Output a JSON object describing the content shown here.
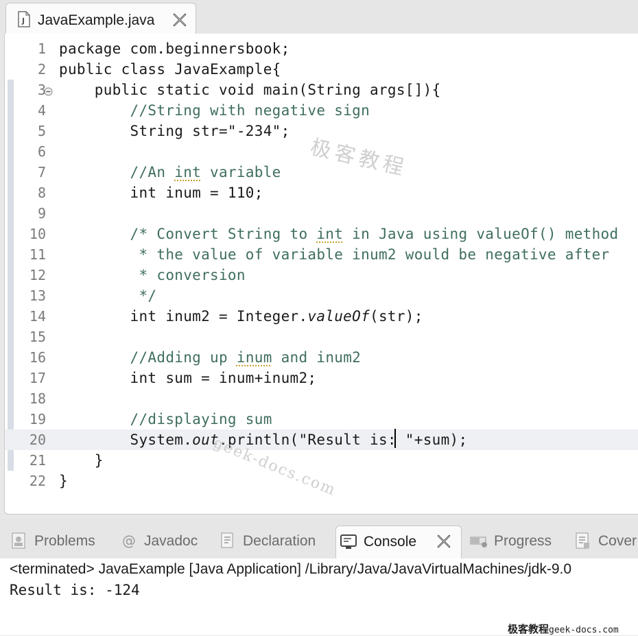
{
  "editor_tab": {
    "title": "JavaExample.java"
  },
  "lines": [
    {
      "n": "1",
      "segs": [
        {
          "t": "package com.beginnersbook;"
        }
      ]
    },
    {
      "n": "2",
      "segs": [
        {
          "t": "public class JavaExample{"
        }
      ]
    },
    {
      "n": "3",
      "fold": true,
      "segs": [
        {
          "t": "    public static void main(String args[]){"
        }
      ]
    },
    {
      "n": "4",
      "segs": [
        {
          "t": "        //String with negative sign",
          "c": "comment"
        }
      ]
    },
    {
      "n": "5",
      "segs": [
        {
          "t": "        String str=\"-234\";"
        }
      ]
    },
    {
      "n": "6",
      "segs": [
        {
          "t": ""
        }
      ]
    },
    {
      "n": "7",
      "segs": [
        {
          "t": "        //An ",
          "c": "comment"
        },
        {
          "t": "int",
          "c": "comment squiggle"
        },
        {
          "t": " variable",
          "c": "comment"
        }
      ]
    },
    {
      "n": "8",
      "segs": [
        {
          "t": "        int inum = 110;"
        }
      ]
    },
    {
      "n": "9",
      "segs": [
        {
          "t": ""
        }
      ]
    },
    {
      "n": "10",
      "segs": [
        {
          "t": "        /* Convert String to ",
          "c": "comment"
        },
        {
          "t": "int",
          "c": "comment squiggle"
        },
        {
          "t": " in Java using valueOf() method",
          "c": "comment"
        }
      ]
    },
    {
      "n": "11",
      "segs": [
        {
          "t": "         * the value of variable inum2 would be negative after",
          "c": "comment"
        }
      ]
    },
    {
      "n": "12",
      "segs": [
        {
          "t": "         * conversion",
          "c": "comment"
        }
      ]
    },
    {
      "n": "13",
      "segs": [
        {
          "t": "         */",
          "c": "comment"
        }
      ]
    },
    {
      "n": "14",
      "segs": [
        {
          "t": "        int inum2 = Integer."
        },
        {
          "t": "valueOf",
          "i": true
        },
        {
          "t": "(str);"
        }
      ]
    },
    {
      "n": "15",
      "segs": [
        {
          "t": ""
        }
      ]
    },
    {
      "n": "16",
      "segs": [
        {
          "t": "        //Adding up ",
          "c": "comment"
        },
        {
          "t": "inum",
          "c": "comment squiggle"
        },
        {
          "t": " and inum2",
          "c": "comment"
        }
      ]
    },
    {
      "n": "17",
      "segs": [
        {
          "t": "        int sum = inum+inum2;"
        }
      ]
    },
    {
      "n": "18",
      "segs": [
        {
          "t": ""
        }
      ]
    },
    {
      "n": "19",
      "segs": [
        {
          "t": "        //displaying sum",
          "c": "comment"
        }
      ]
    },
    {
      "n": "20",
      "current": true,
      "segs": [
        {
          "t": "        System."
        },
        {
          "t": "out",
          "i": true
        },
        {
          "t": ".println(\"Result is: \"+sum);"
        }
      ]
    },
    {
      "n": "21",
      "segs": [
        {
          "t": "    }"
        }
      ]
    },
    {
      "n": "22",
      "segs": [
        {
          "t": "}"
        }
      ]
    }
  ],
  "watermarks": {
    "cn": "极客教程",
    "domain": "geek-docs.com",
    "footer_cn": "极客教程",
    "footer_domain": "geek-docs.com"
  },
  "panel": {
    "tabs": [
      {
        "label": "Problems",
        "icon": "problems-icon",
        "active": false
      },
      {
        "label": "Javadoc",
        "icon": "at-icon",
        "active": false
      },
      {
        "label": "Declaration",
        "icon": "declaration-icon",
        "active": false
      },
      {
        "label": "Console",
        "icon": "console-icon",
        "active": true
      },
      {
        "label": "Progress",
        "icon": "progress-icon",
        "active": false
      },
      {
        "label": "Cover",
        "icon": "coverage-icon",
        "active": false
      }
    ],
    "status": "<terminated> JavaExample [Java Application] /Library/Java/JavaVirtualMachines/jdk-9.0",
    "output": "Result is: -124"
  }
}
